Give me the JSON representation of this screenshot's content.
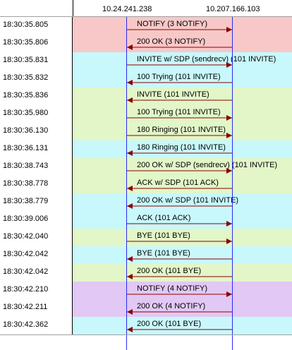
{
  "hosts": {
    "left": "10.24.241.238",
    "right": "10.207.166.103"
  },
  "colors": {
    "red_bg": "#f8c8c8",
    "cyan_bg": "#c8f8fc",
    "green_bg": "#e2f6c8",
    "purple_bg": "#e2c8f4",
    "arrow": "#8b0000",
    "host_line": "#2a2af0"
  },
  "rows": [
    {
      "time": "18:30:35.805",
      "label": "NOTIFY (3 NOTIFY)",
      "dir": "right",
      "bg": "red"
    },
    {
      "time": "18:30:35.806",
      "label": "200 OK (3 NOTIFY)",
      "dir": "left",
      "bg": "red"
    },
    {
      "time": "18:30:35.831",
      "label": "INVITE w/ SDP (sendrecv)  (101 INVITE)",
      "dir": "right",
      "bg": "cyan"
    },
    {
      "time": "18:30:35.832",
      "label": "100 Trying (101 INVITE)",
      "dir": "left",
      "bg": "cyan"
    },
    {
      "time": "18:30:35.836",
      "label": "INVITE (101 INVITE)",
      "dir": "left",
      "bg": "green"
    },
    {
      "time": "18:30:35.980",
      "label": "100 Trying (101 INVITE)",
      "dir": "right",
      "bg": "green"
    },
    {
      "time": "18:30:36.130",
      "label": "180 Ringing (101 INVITE)",
      "dir": "right",
      "bg": "green"
    },
    {
      "time": "18:30:36.131",
      "label": "180 Ringing (101 INVITE)",
      "dir": "left",
      "bg": "cyan"
    },
    {
      "time": "18:30:38.743",
      "label": "200 OK w/ SDP (sendrecv)  (101 INVITE)",
      "dir": "right",
      "bg": "green"
    },
    {
      "time": "18:30:38.778",
      "label": "ACK w/ SDP (101 ACK)",
      "dir": "left",
      "bg": "green"
    },
    {
      "time": "18:30:38.779",
      "label": "200 OK w/ SDP (101 INVITE)",
      "dir": "left",
      "bg": "cyan"
    },
    {
      "time": "18:30:39.006",
      "label": "ACK (101 ACK)",
      "dir": "right",
      "bg": "cyan"
    },
    {
      "time": "18:30:42.040",
      "label": "BYE (101 BYE)",
      "dir": "right",
      "bg": "green"
    },
    {
      "time": "18:30:42.042",
      "label": "BYE (101 BYE)",
      "dir": "left",
      "bg": "cyan"
    },
    {
      "time": "18:30:42.042",
      "label": "200 OK (101 BYE)",
      "dir": "left",
      "bg": "green"
    },
    {
      "time": "18:30:42.210",
      "label": "NOTIFY (4 NOTIFY)",
      "dir": "right",
      "bg": "purple"
    },
    {
      "time": "18:30:42.211",
      "label": "200 OK (4 NOTIFY)",
      "dir": "left",
      "bg": "purple"
    },
    {
      "time": "18:30:42.362",
      "label": "200 OK (101 BYE)",
      "dir": "left",
      "bg": "cyan"
    }
  ]
}
